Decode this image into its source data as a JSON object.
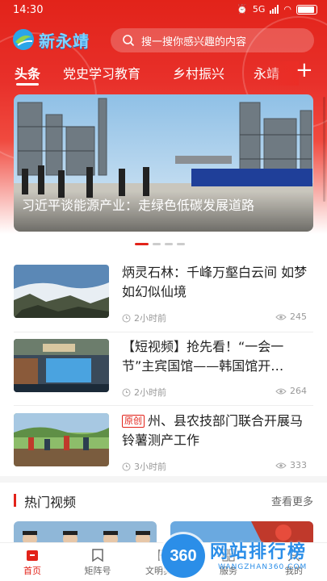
{
  "status_bar": {
    "time": "14:30",
    "network": "5G",
    "battery": "88"
  },
  "header": {
    "logo_text": "新永靖",
    "search_placeholder": "搜一搜你感兴趣的内容"
  },
  "tabs": [
    {
      "label": "头条",
      "active": true
    },
    {
      "label": "党史学习教育",
      "active": false
    },
    {
      "label": "乡村振兴",
      "active": false
    },
    {
      "label": "永靖",
      "active": false
    }
  ],
  "banner": {
    "caption": "习近平谈能源产业：走绿色低碳发展道路",
    "slide_count": 4,
    "active_slide": 1
  },
  "news": [
    {
      "title": "炳灵石林：千峰万壑白云间 如梦如幻似仙境",
      "time": "2小时前",
      "views": "245",
      "original": false
    },
    {
      "title": "【短视频】抢先看！“一会一节”主宾国馆——韩国馆开…",
      "time": "2小时前",
      "views": "264",
      "original": false
    },
    {
      "title": "州、县农技部门联合开展马铃薯测产工作",
      "time": "3小时前",
      "views": "333",
      "original": true,
      "tag": "原创"
    }
  ],
  "hot_videos": {
    "title": "热门视频",
    "more": "查看更多"
  },
  "bottom_nav": [
    {
      "label": "首页",
      "icon": "home-icon",
      "active": true
    },
    {
      "label": "矩阵号",
      "icon": "bookmark-icon",
      "active": false
    },
    {
      "label": "文明实践",
      "icon": "flag-icon",
      "active": false
    },
    {
      "label": "服务",
      "icon": "grid-icon",
      "active": false
    },
    {
      "label": "我的",
      "icon": "user-icon",
      "active": false
    }
  ],
  "watermark": {
    "badge": "360",
    "text": "网站排行榜",
    "sub": "WANGZHAN360.COM"
  },
  "colors": {
    "brand_red": "#e2231a",
    "watermark_blue": "#2b8ee8"
  }
}
